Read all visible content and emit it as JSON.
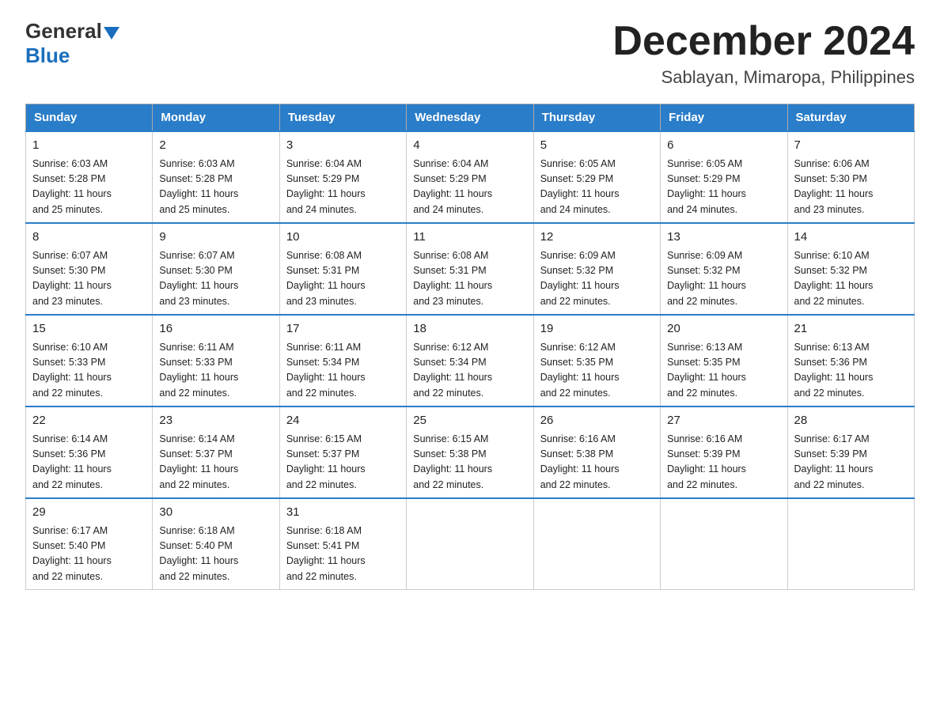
{
  "logo": {
    "general": "General",
    "blue": "Blue"
  },
  "header": {
    "month": "December 2024",
    "location": "Sablayan, Mimaropa, Philippines"
  },
  "weekdays": [
    "Sunday",
    "Monday",
    "Tuesday",
    "Wednesday",
    "Thursday",
    "Friday",
    "Saturday"
  ],
  "weeks": [
    [
      {
        "day": "1",
        "sunrise": "6:03 AM",
        "sunset": "5:28 PM",
        "daylight": "11 hours and 25 minutes."
      },
      {
        "day": "2",
        "sunrise": "6:03 AM",
        "sunset": "5:28 PM",
        "daylight": "11 hours and 25 minutes."
      },
      {
        "day": "3",
        "sunrise": "6:04 AM",
        "sunset": "5:29 PM",
        "daylight": "11 hours and 24 minutes."
      },
      {
        "day": "4",
        "sunrise": "6:04 AM",
        "sunset": "5:29 PM",
        "daylight": "11 hours and 24 minutes."
      },
      {
        "day": "5",
        "sunrise": "6:05 AM",
        "sunset": "5:29 PM",
        "daylight": "11 hours and 24 minutes."
      },
      {
        "day": "6",
        "sunrise": "6:05 AM",
        "sunset": "5:29 PM",
        "daylight": "11 hours and 24 minutes."
      },
      {
        "day": "7",
        "sunrise": "6:06 AM",
        "sunset": "5:30 PM",
        "daylight": "11 hours and 23 minutes."
      }
    ],
    [
      {
        "day": "8",
        "sunrise": "6:07 AM",
        "sunset": "5:30 PM",
        "daylight": "11 hours and 23 minutes."
      },
      {
        "day": "9",
        "sunrise": "6:07 AM",
        "sunset": "5:30 PM",
        "daylight": "11 hours and 23 minutes."
      },
      {
        "day": "10",
        "sunrise": "6:08 AM",
        "sunset": "5:31 PM",
        "daylight": "11 hours and 23 minutes."
      },
      {
        "day": "11",
        "sunrise": "6:08 AM",
        "sunset": "5:31 PM",
        "daylight": "11 hours and 23 minutes."
      },
      {
        "day": "12",
        "sunrise": "6:09 AM",
        "sunset": "5:32 PM",
        "daylight": "11 hours and 22 minutes."
      },
      {
        "day": "13",
        "sunrise": "6:09 AM",
        "sunset": "5:32 PM",
        "daylight": "11 hours and 22 minutes."
      },
      {
        "day": "14",
        "sunrise": "6:10 AM",
        "sunset": "5:32 PM",
        "daylight": "11 hours and 22 minutes."
      }
    ],
    [
      {
        "day": "15",
        "sunrise": "6:10 AM",
        "sunset": "5:33 PM",
        "daylight": "11 hours and 22 minutes."
      },
      {
        "day": "16",
        "sunrise": "6:11 AM",
        "sunset": "5:33 PM",
        "daylight": "11 hours and 22 minutes."
      },
      {
        "day": "17",
        "sunrise": "6:11 AM",
        "sunset": "5:34 PM",
        "daylight": "11 hours and 22 minutes."
      },
      {
        "day": "18",
        "sunrise": "6:12 AM",
        "sunset": "5:34 PM",
        "daylight": "11 hours and 22 minutes."
      },
      {
        "day": "19",
        "sunrise": "6:12 AM",
        "sunset": "5:35 PM",
        "daylight": "11 hours and 22 minutes."
      },
      {
        "day": "20",
        "sunrise": "6:13 AM",
        "sunset": "5:35 PM",
        "daylight": "11 hours and 22 minutes."
      },
      {
        "day": "21",
        "sunrise": "6:13 AM",
        "sunset": "5:36 PM",
        "daylight": "11 hours and 22 minutes."
      }
    ],
    [
      {
        "day": "22",
        "sunrise": "6:14 AM",
        "sunset": "5:36 PM",
        "daylight": "11 hours and 22 minutes."
      },
      {
        "day": "23",
        "sunrise": "6:14 AM",
        "sunset": "5:37 PM",
        "daylight": "11 hours and 22 minutes."
      },
      {
        "day": "24",
        "sunrise": "6:15 AM",
        "sunset": "5:37 PM",
        "daylight": "11 hours and 22 minutes."
      },
      {
        "day": "25",
        "sunrise": "6:15 AM",
        "sunset": "5:38 PM",
        "daylight": "11 hours and 22 minutes."
      },
      {
        "day": "26",
        "sunrise": "6:16 AM",
        "sunset": "5:38 PM",
        "daylight": "11 hours and 22 minutes."
      },
      {
        "day": "27",
        "sunrise": "6:16 AM",
        "sunset": "5:39 PM",
        "daylight": "11 hours and 22 minutes."
      },
      {
        "day": "28",
        "sunrise": "6:17 AM",
        "sunset": "5:39 PM",
        "daylight": "11 hours and 22 minutes."
      }
    ],
    [
      {
        "day": "29",
        "sunrise": "6:17 AM",
        "sunset": "5:40 PM",
        "daylight": "11 hours and 22 minutes."
      },
      {
        "day": "30",
        "sunrise": "6:18 AM",
        "sunset": "5:40 PM",
        "daylight": "11 hours and 22 minutes."
      },
      {
        "day": "31",
        "sunrise": "6:18 AM",
        "sunset": "5:41 PM",
        "daylight": "11 hours and 22 minutes."
      },
      null,
      null,
      null,
      null
    ]
  ],
  "labels": {
    "sunrise": "Sunrise:",
    "sunset": "Sunset:",
    "daylight": "Daylight:"
  }
}
